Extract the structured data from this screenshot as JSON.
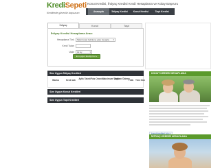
{
  "logo": {
    "name_part1": "Kredi",
    "name_part2": "Sepeti",
    "tagline": "Kredilerde güvenilir başvurum"
  },
  "header": {
    "title": "Konut Kredisi, İhtiyaç Kredisi Kredi Hesaplama ve Kolay Başvuru"
  },
  "topnav": {
    "items": [
      "Anasayfa",
      "İhtiyaç Kredisi",
      "Konut Kredisi",
      "Taşıt Kredisi"
    ],
    "active_index": 0
  },
  "tabs": {
    "items": [
      "İhtiyaç",
      "Konut",
      "Taşıt"
    ],
    "active_index": 0
  },
  "form": {
    "heading": "İhtiyaç Kredisi Hesaplama Aracı",
    "fields": [
      {
        "label": "Hesaplama Türü",
        "value": "Taksit tutarı belirleme göre hesapla"
      },
      {
        "label": "Kredi Tutarı",
        "value": ""
      },
      {
        "label": "Vade",
        "value": "12 Ay"
      }
    ],
    "submit_label": "En uygun krediyi bul »"
  },
  "bars": {
    "results_title": "Size Uygun İhtiyaç Kredileri",
    "konut_title": "Size Uygun Konut Kredileri",
    "tasit_title": "Size Uygun Taşıt Kredileri"
  },
  "results_table": {
    "columns": [
      "Banka",
      "Kredi Adı",
      "Aylık Taksit",
      "Faiz Oranı",
      "Maksimum Vade",
      "Toplam Ödeme",
      "Yıllık",
      "Tüm Gün"
    ]
  },
  "sidebar": {
    "konut_header": "KONUT KREDİSİ HESAPLAMA",
    "konut_link": "konut kredileri için »",
    "ihtiyac_header": "İHTİYAÇ KREDİSİ HESAPLAMA"
  }
}
